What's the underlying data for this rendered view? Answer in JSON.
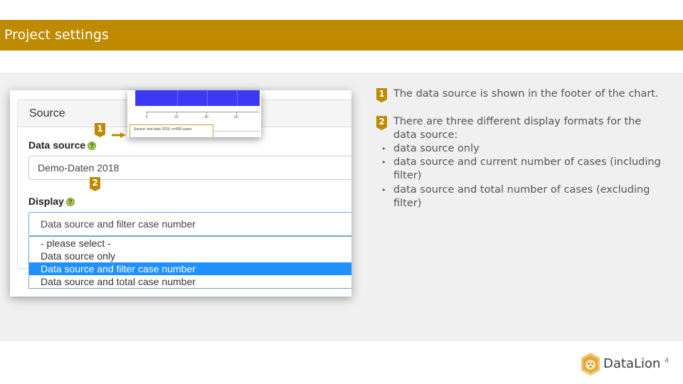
{
  "header": {
    "title": "Project settings"
  },
  "screenshot": {
    "panel_title": "Source",
    "data_source_label": "Data source",
    "data_source_value": "Demo-Daten 2018",
    "display_label": "Display",
    "help_icon": "?",
    "display_value": "Data source and filter case number",
    "display_options": [
      "- please select -",
      "Data source only",
      "Data source and filter case number",
      "Data source and total case number"
    ],
    "selected_option_index": 2
  },
  "inset": {
    "tick_labels": [
      "0",
      "20",
      "40",
      "60"
    ],
    "footer_text": "Source: test data 2019, n=500 cases",
    "bar_color": "#3a3af5"
  },
  "markers": {
    "one": "1",
    "two": "2"
  },
  "notes": {
    "item1": "The data source is shown in the footer of the chart.",
    "item2_line1": "There are three different display formats for the",
    "item2_line2": "data source:",
    "bullets": [
      {
        "line1": "data source only",
        "line2": ""
      },
      {
        "line1": "data source and current number of cases (including",
        "line2": "filter)"
      },
      {
        "line1": "data source and total number of cases (excluding",
        "line2": "filter)"
      }
    ]
  },
  "footer": {
    "brand": "DataLion",
    "page_number": "4"
  },
  "colors": {
    "accent": "#bf8a00",
    "selection": "#1e90ff",
    "band": "#f0f0f0"
  }
}
